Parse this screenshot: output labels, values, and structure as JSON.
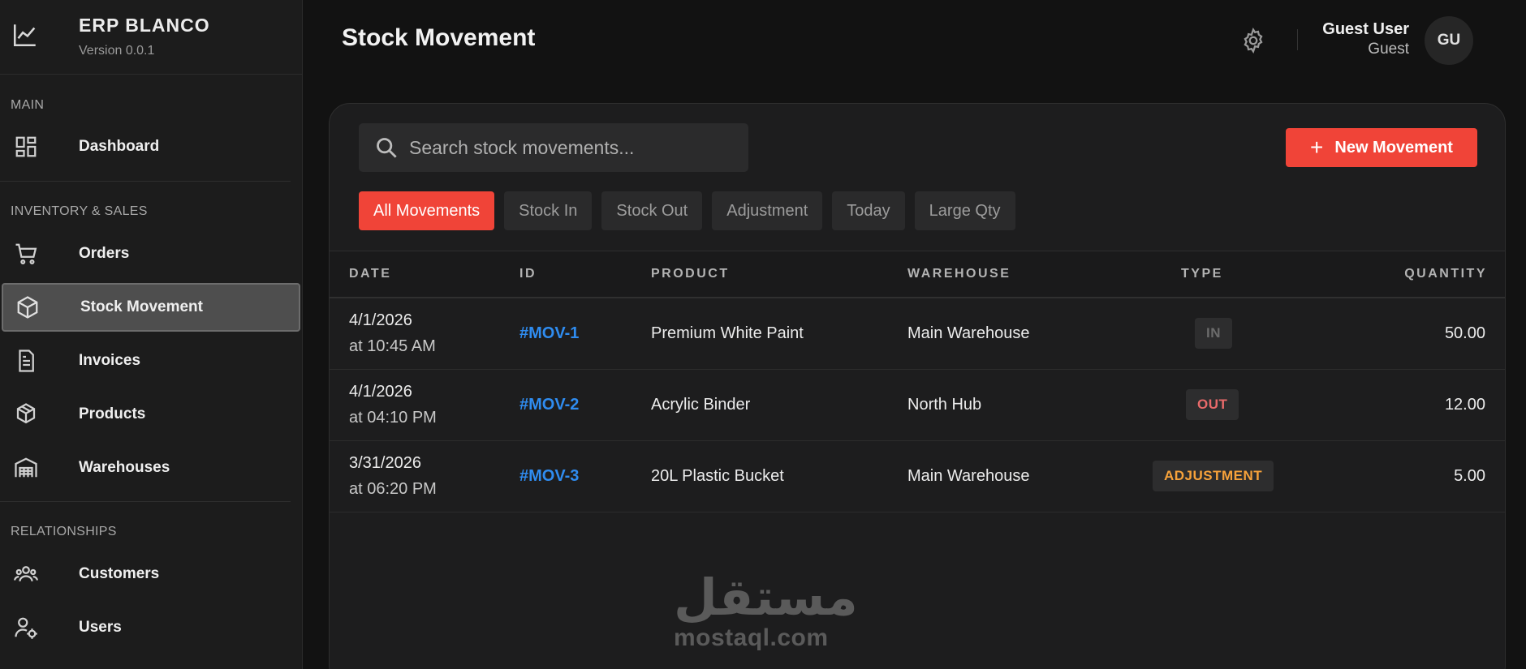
{
  "app": {
    "name": "ERP BLANCO",
    "version": "Version 0.0.1"
  },
  "sidebar": {
    "sections": [
      {
        "label": "MAIN",
        "items": [
          {
            "label": "Dashboard",
            "icon": "dashboard-icon"
          }
        ]
      },
      {
        "label": "INVENTORY & SALES",
        "items": [
          {
            "label": "Orders",
            "icon": "cart-icon"
          },
          {
            "label": "Stock Movement",
            "icon": "cube-icon",
            "active": true
          },
          {
            "label": "Invoices",
            "icon": "document-icon"
          },
          {
            "label": "Products",
            "icon": "boxes-icon"
          },
          {
            "label": "Warehouses",
            "icon": "warehouse-icon"
          }
        ]
      },
      {
        "label": "RELATIONSHIPS",
        "items": [
          {
            "label": "Customers",
            "icon": "people-icon"
          },
          {
            "label": "Users",
            "icon": "user-settings-icon"
          }
        ]
      }
    ]
  },
  "header": {
    "title": "Stock Movement",
    "user": {
      "name": "Guest User",
      "role": "Guest",
      "initials": "GU"
    }
  },
  "toolbar": {
    "search_placeholder": "Search stock movements...",
    "new_button": "New Movement"
  },
  "filters": [
    "All Movements",
    "Stock In",
    "Stock Out",
    "Adjustment",
    "Today",
    "Large Qty"
  ],
  "table": {
    "columns": [
      "DATE",
      "ID",
      "PRODUCT",
      "WAREHOUSE",
      "TYPE",
      "QUANTITY"
    ],
    "rows": [
      {
        "date": "4/1/2026",
        "time": "at 10:45 AM",
        "id": "#MOV-1",
        "product": "Premium White Paint",
        "warehouse": "Main Warehouse",
        "type": "IN",
        "quantity": "50.00"
      },
      {
        "date": "4/1/2026",
        "time": "at 04:10 PM",
        "id": "#MOV-2",
        "product": "Acrylic Binder",
        "warehouse": "North Hub",
        "type": "OUT",
        "quantity": "12.00"
      },
      {
        "date": "3/31/2026",
        "time": "at 06:20 PM",
        "id": "#MOV-3",
        "product": "20L Plastic Bucket",
        "warehouse": "Main Warehouse",
        "type": "ADJUSTMENT",
        "quantity": "5.00"
      }
    ]
  },
  "watermark": {
    "arabic": "مستقل",
    "latin": "mostaql.com"
  },
  "colors": {
    "accent": "#f04438",
    "link": "#2f8cf0",
    "out": "#e86a6a",
    "adjustment": "#f7a23a"
  }
}
